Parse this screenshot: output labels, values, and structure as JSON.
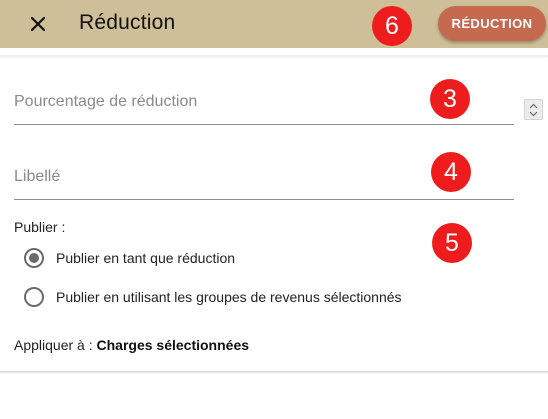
{
  "header": {
    "title": "Réduction",
    "action_label": "RÉDUCTION",
    "close_icon": "close-icon",
    "background": "#cfbf98",
    "action_color": "#c5694f"
  },
  "annotations": {
    "badge_6": "6",
    "badge_3": "3",
    "badge_4": "4",
    "badge_5": "5",
    "badge_color": "#ee1c1c"
  },
  "form": {
    "percentage": {
      "placeholder": "Pourcentage de réduction",
      "value": ""
    },
    "label": {
      "placeholder": "Libellé",
      "value": ""
    },
    "publish_label": "Publier :",
    "publish_options": [
      {
        "label": "Publier en tant que réduction",
        "selected": true
      },
      {
        "label": "Publier en utilisant les groupes de revenus sélectionnés",
        "selected": false
      }
    ],
    "apply_prefix": "Appliquer à :",
    "apply_value": "Charges sélectionnées"
  }
}
